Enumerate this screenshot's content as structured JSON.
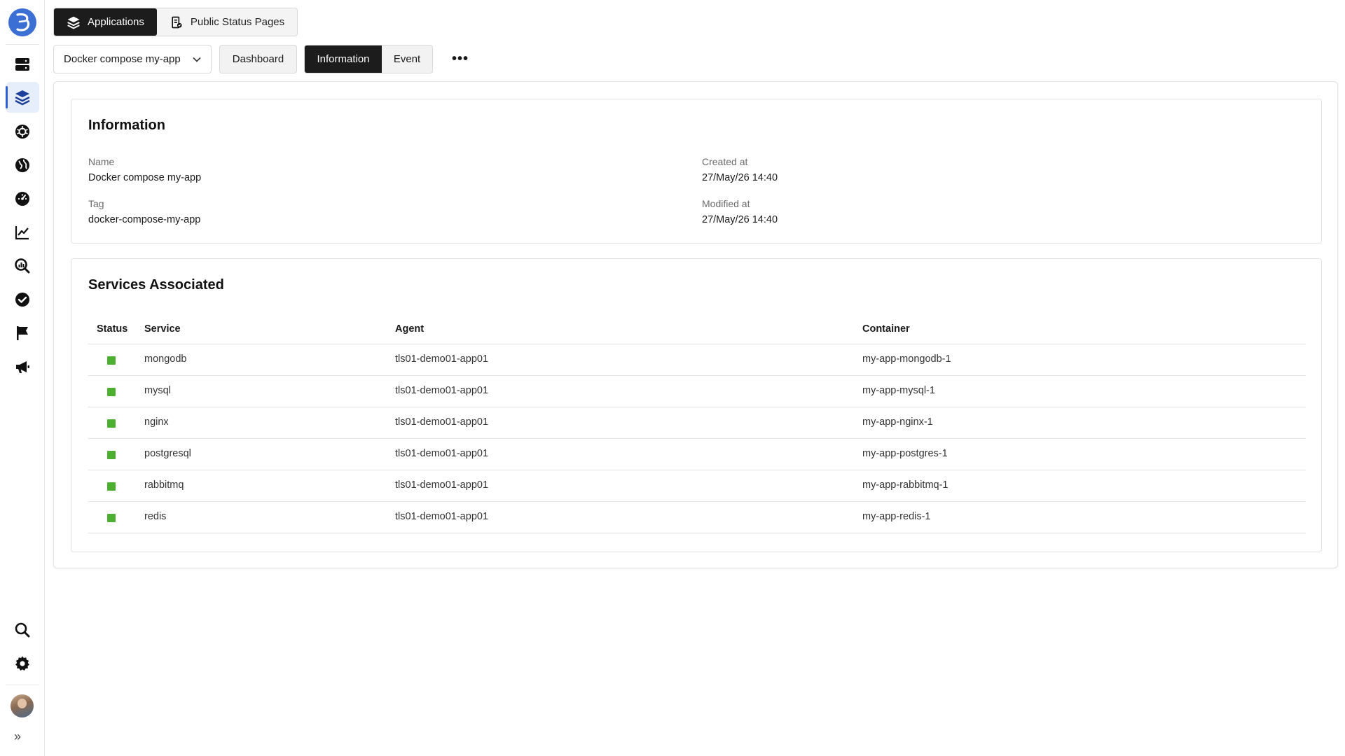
{
  "top_tabs": [
    {
      "label": "Applications",
      "icon": "layers-icon",
      "active": true
    },
    {
      "label": "Public Status Pages",
      "icon": "status-page-icon",
      "active": false
    }
  ],
  "toolbar": {
    "app_select_value": "Docker compose my-app",
    "dashboard_label": "Dashboard",
    "information_label": "Information",
    "event_label": "Event",
    "more_label": "•••"
  },
  "info": {
    "title": "Information",
    "name_label": "Name",
    "name_value": "Docker compose my-app",
    "tag_label": "Tag",
    "tag_value": "docker-compose-my-app",
    "created_label": "Created at",
    "created_value": "27/May/26 14:40",
    "modified_label": "Modified at",
    "modified_value": "27/May/26 14:40"
  },
  "services": {
    "title": "Services Associated",
    "columns": [
      "Status",
      "Service",
      "Agent",
      "Container"
    ],
    "status_color": "#4caf30",
    "rows": [
      {
        "service": "mongodb",
        "agent": "tls01-demo01-app01",
        "container": "my-app-mongodb-1"
      },
      {
        "service": "mysql",
        "agent": "tls01-demo01-app01",
        "container": "my-app-mysql-1"
      },
      {
        "service": "nginx",
        "agent": "tls01-demo01-app01",
        "container": "my-app-nginx-1"
      },
      {
        "service": "postgresql",
        "agent": "tls01-demo01-app01",
        "container": "my-app-postgres-1"
      },
      {
        "service": "rabbitmq",
        "agent": "tls01-demo01-app01",
        "container": "my-app-rabbitmq-1"
      },
      {
        "service": "redis",
        "agent": "tls01-demo01-app01",
        "container": "my-app-redis-1"
      }
    ]
  },
  "sidebar": {
    "items": [
      {
        "icon": "server-icon",
        "active": false
      },
      {
        "icon": "layers-icon",
        "active": true
      },
      {
        "icon": "kubernetes-icon",
        "active": false
      },
      {
        "icon": "globe-icon",
        "active": false
      },
      {
        "icon": "dashboard-gauge-icon",
        "active": false
      },
      {
        "icon": "chart-line-icon",
        "active": false
      },
      {
        "icon": "search-analytics-icon",
        "active": false
      },
      {
        "icon": "check-circle-icon",
        "active": false
      },
      {
        "icon": "flag-icon",
        "active": false
      },
      {
        "icon": "megaphone-icon",
        "active": false
      }
    ],
    "bottom": [
      {
        "icon": "search-icon"
      },
      {
        "icon": "gear-icon"
      }
    ],
    "expand_label": "»"
  },
  "colors": {
    "accent": "#2f5fd0",
    "dark": "#1c1c1c",
    "status_ok": "#4caf30"
  }
}
